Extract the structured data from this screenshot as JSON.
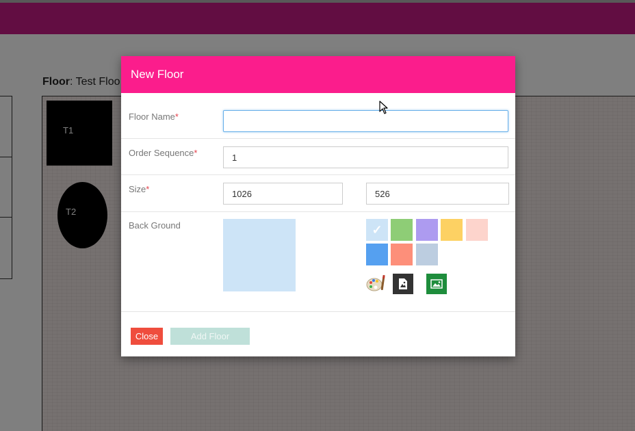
{
  "page": {
    "floor_label_bold": "Floor",
    "floor_label_value": ": Test Floo",
    "topbar_color": "#c41a84",
    "tables": [
      {
        "label": "T1",
        "shape": "square"
      },
      {
        "label": "T2",
        "shape": "oval"
      }
    ]
  },
  "modal": {
    "title": "New Floor",
    "header_color": "#fb1d8c",
    "floor_name": {
      "label": "Floor Name",
      "required_mark": "*",
      "value": ""
    },
    "order_sequence": {
      "label": "Order Sequence",
      "required_mark": "*",
      "value": "1"
    },
    "size": {
      "label": "Size",
      "required_mark": "*",
      "width": "1026",
      "height": "526"
    },
    "background": {
      "label": "Back Ground",
      "selected_color": "#cde4f7",
      "swatches": [
        {
          "color": "#cde4f7",
          "selected": true
        },
        {
          "color": "#8ecd76",
          "selected": false
        },
        {
          "color": "#ad9bf0",
          "selected": false
        },
        {
          "color": "#fdd163",
          "selected": false
        },
        {
          "color": "#fdd4cc",
          "selected": false
        },
        {
          "color": "#55a0f0",
          "selected": false
        },
        {
          "color": "#fd8f7a",
          "selected": false
        },
        {
          "color": "#bccde0",
          "selected": false
        }
      ],
      "tools": [
        "palette-icon",
        "image-upload-icon",
        "image-icon"
      ]
    },
    "footer": {
      "close_label": "Close",
      "close_color": "#ef4d3d",
      "add_label": "Add Floor",
      "add_color": "#bfe0d9"
    }
  }
}
